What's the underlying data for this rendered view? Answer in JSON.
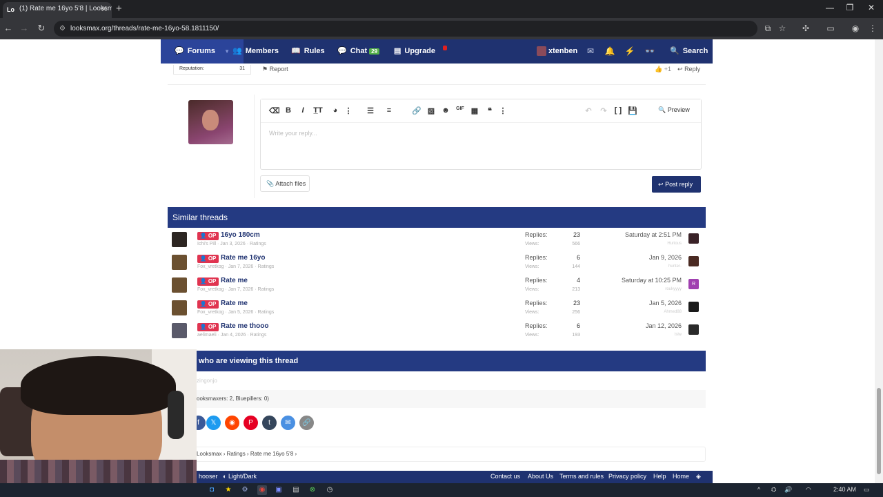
{
  "browser": {
    "tab_title": "(1) Rate me 16yo 5'8 | Looksma",
    "tab_favicon": "Lo",
    "url": "looksmax.org/threads/rate-me-16yo-58.1811150/"
  },
  "nav": {
    "forums": "Forums",
    "members": "Members",
    "rules": "Rules",
    "chat": "Chat",
    "chat_badge": "29",
    "upgrade": "Upgrade",
    "username": "xtenben",
    "alerts_badge": "1",
    "search": "Search"
  },
  "post_footer": {
    "reputation_label": "Reputation:",
    "reputation_value": "31",
    "report": "Report",
    "likes": "+1",
    "reply": "Reply"
  },
  "editor": {
    "placeholder": "Write your reply...",
    "preview": "Preview",
    "attach": "Attach files",
    "post_reply": "Post reply"
  },
  "similar": {
    "heading": "Similar threads",
    "replies_label": "Replies:",
    "views_label": "Views:",
    "prefix": "OP",
    "threads": [
      {
        "title": "16yo 180cm",
        "meta": "Ichi's Pill · Jan 3, 2026 · Ratings",
        "replies": "23",
        "views": "566",
        "date": "Saturday at 2:51 PM",
        "last_user": "Hurious"
      },
      {
        "title": "Rate me 16yo",
        "meta": "Fox_vretkog · Jan 7, 2026 · Ratings",
        "replies": "6",
        "views": "144",
        "date": "Jan 9, 2026",
        "last_user": "hunter-"
      },
      {
        "title": "Rate me",
        "meta": "Fox_vretkog · Jan 7, 2026 · Ratings",
        "replies": "4",
        "views": "213",
        "date": "Saturday at 10:25 PM",
        "last_user": "roukyyyy"
      },
      {
        "title": "Rate me",
        "meta": "Fox_vretkog · Jan 5, 2026 · Ratings",
        "replies": "23",
        "views": "256",
        "date": "Jan 5, 2026",
        "last_user": "Ahmed88"
      },
      {
        "title": "Rate me thooo",
        "meta": "aelimaeli · Jan 4, 2026 · Ratings",
        "replies": "6",
        "views": "193",
        "date": "Jan 12, 2026",
        "last_user": "Islw"
      }
    ]
  },
  "viewing": {
    "heading": "who are viewing this thread",
    "viewers": "zingonjo",
    "count": "ooksmaxers: 2, Bluepillers: 0)"
  },
  "breadcrumb": [
    "Looksmax",
    "Ratings",
    "Rate me 16yo 5'8"
  ],
  "footer": {
    "chooser": "hooser",
    "theme": "Light/Dark",
    "contact": "Contact us",
    "about": "About Us",
    "terms": "Terms and rules",
    "privacy": "Privacy policy",
    "help": "Help",
    "home": "Home"
  },
  "taskbar": {
    "time": "2:40 AM"
  },
  "colors": {
    "nav": "#1f3270",
    "block_header": "#243a82",
    "op_badge": "#e03450",
    "chat_badge": "#55b248"
  }
}
